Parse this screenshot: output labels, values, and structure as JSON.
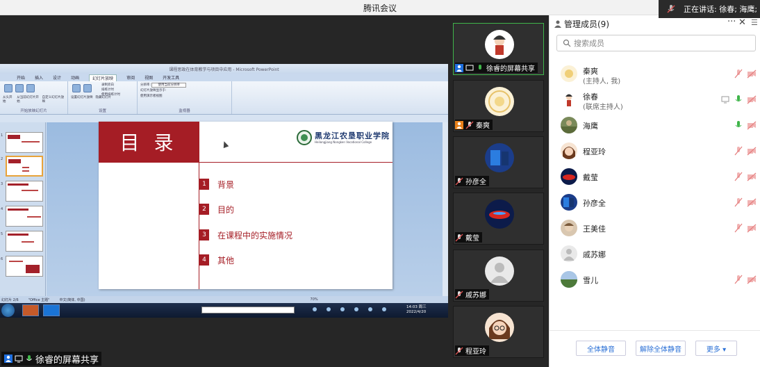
{
  "window": {
    "title": "腾讯会议"
  },
  "speaking": {
    "label": "正在讲话: 徐春; 海鹰;"
  },
  "share": {
    "label": "徐睿的屏幕共享",
    "ppt": {
      "title": "课程思政在体育教学与项目中应用 - Microsoft PowerPoint",
      "tabs": [
        "开始",
        "插入",
        "设计",
        "动画",
        "幻灯片放映",
        "审阅",
        "视图",
        "开发工具"
      ],
      "active_tab": "幻灯片放映",
      "ribbon_groups": [
        "开始放映幻灯片",
        "设置",
        "监视器"
      ],
      "ribbon_items": [
        "从头开始",
        "从当前幻灯片开始",
        "自定义幻灯片放映",
        "设置幻灯片放映",
        "隐藏幻灯片",
        "录制旁白",
        "排练计时",
        "使用排练计时",
        "分辨率:",
        "使用当前分辨率",
        "幻灯片放映显示于:",
        "使用演示者视图"
      ],
      "status_items": [
        "幻灯片 2/6",
        "\"Office 主题\"",
        "中文(简体, 中国)"
      ],
      "zoom": "70%",
      "clock_time": "14:03 周三",
      "clock_date": "2022/4/20",
      "thumb_numbers": [
        "1",
        "2",
        "3",
        "4",
        "5",
        "6"
      ]
    },
    "slide": {
      "heading": "目 录",
      "school_cn": "黑龙江农垦职业学院",
      "school_en": "Heilongjiang Nongken Vocational College",
      "items": [
        {
          "num": "1",
          "text": "背景"
        },
        {
          "num": "2",
          "text": "目的"
        },
        {
          "num": "3",
          "text": "在课程中的实施情况"
        },
        {
          "num": "4",
          "text": "其他"
        }
      ]
    }
  },
  "videos": [
    {
      "name": "徐睿的屏幕共享",
      "active": true
    },
    {
      "name": "秦爽"
    },
    {
      "name": "孙彦全"
    },
    {
      "name": "戴莹"
    },
    {
      "name": "戚苏娜"
    },
    {
      "name": "程亚玲"
    }
  ],
  "panel": {
    "title": "管理成员(9)",
    "search_placeholder": "搜索成员",
    "members": [
      {
        "name": "秦爽",
        "role": "(主持人, 我)"
      },
      {
        "name": "徐春",
        "role": "(联席主持人)"
      },
      {
        "name": "海鹰",
        "role": ""
      },
      {
        "name": "程亚玲",
        "role": ""
      },
      {
        "name": "戴莹",
        "role": ""
      },
      {
        "name": "孙彦全",
        "role": ""
      },
      {
        "name": "王美佳",
        "role": ""
      },
      {
        "name": "戚苏娜",
        "role": ""
      },
      {
        "name": "雪儿",
        "role": ""
      }
    ],
    "buttons": {
      "mute_all": "全体静音",
      "unmute_all": "解除全体静音",
      "more": "更多 ▾"
    }
  },
  "colors": {
    "slide_red": "#a51d25",
    "mic_on": "#3fb54a",
    "mic_off": "#e08080",
    "link_blue": "#2a6fd6"
  }
}
